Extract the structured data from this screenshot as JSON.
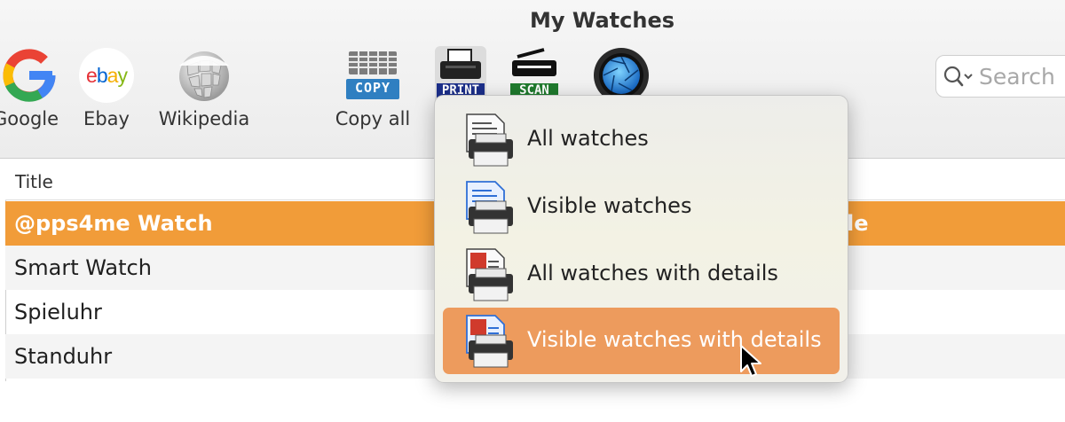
{
  "window": {
    "title": "My Watches"
  },
  "toolbar": {
    "items": [
      {
        "label": "Google",
        "icon": "google-icon"
      },
      {
        "label": "Ebay",
        "icon": "ebay-icon"
      },
      {
        "label": "Wikipedia",
        "icon": "wikipedia-icon"
      },
      {
        "label": "Copy all",
        "icon": "copy-icon",
        "badge": "COPY"
      },
      {
        "label": "",
        "icon": "print-icon",
        "badge": "PRINT"
      },
      {
        "label": "",
        "icon": "scan-icon",
        "badge": "SCAN"
      },
      {
        "label": "",
        "icon": "aperture-icon"
      }
    ],
    "ebay_letters": [
      "e",
      "b",
      "a",
      "y"
    ],
    "google_letter": "G",
    "search_placeholder": "Search"
  },
  "table": {
    "column_title": "Title",
    "rows": [
      {
        "title": "@pps4me Watch",
        "trailing": "le",
        "selected": true
      },
      {
        "title": "Smart Watch"
      },
      {
        "title": "Spieluhr"
      },
      {
        "title": "Standuhr"
      }
    ]
  },
  "print_menu": {
    "items": [
      {
        "label": "All watches"
      },
      {
        "label": "Visible watches"
      },
      {
        "label": "All watches with details"
      },
      {
        "label": "Visible watches with details",
        "highlighted": true
      }
    ]
  },
  "colors": {
    "selection": "#f19c39",
    "menu_highlight": "#ed9b5d",
    "ebay": [
      "#e53238",
      "#0064d2",
      "#f5af02",
      "#86b817"
    ]
  }
}
